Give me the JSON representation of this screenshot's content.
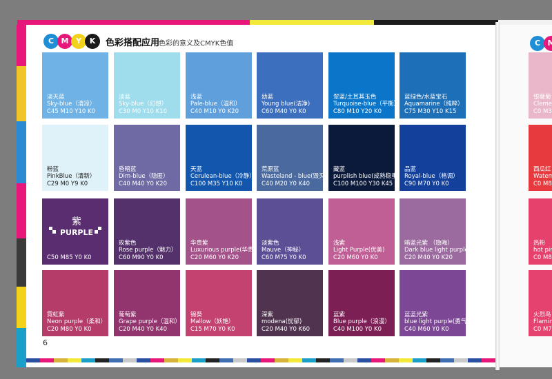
{
  "colors": {
    "cyan": "#1e8fd6",
    "magenta": "#e8177a",
    "yellow": "#f2d21b",
    "black": "#1a1a1a",
    "strip": [
      "#2b4fa3",
      "#e8177a",
      "#d8b33a",
      "#f2e93a",
      "#1aa0c8",
      "#232323",
      "#3f6fb0",
      "#c9c9c9"
    ]
  },
  "header": {
    "c": "C",
    "m": "M",
    "y": "Y",
    "k": "K",
    "title": "色彩搭配应用",
    "subtitle": "色彩的意义及CMYK色值"
  },
  "page_number": "6",
  "swatches": [
    {
      "color": "#6fb3e6",
      "name_cn": "淡天蓝",
      "name_en": "Sky-blue（清凉）",
      "cmyk": "C45 M10 Y10 K0"
    },
    {
      "color": "#9fdcec",
      "name_cn": "淡蓝",
      "name_en": "Sky-blue（幻想）",
      "cmyk": "C30 M0 Y10 K10"
    },
    {
      "color": "#5e9fdc",
      "name_cn": "浅蓝",
      "name_en": "Pale-blue（温和）",
      "cmyk": "C40 M10 Y0 K20"
    },
    {
      "color": "#3d6fbf",
      "name_cn": "幼蓝",
      "name_en": "Young blue(洁净)",
      "cmyk": "C60 M40 Y0 K0"
    },
    {
      "color": "#0b76c9",
      "name_cn": "翠蓝/土耳其玉色",
      "name_en": "Turquoise-blue（平衡）",
      "cmyk": "C80 M10 Y20 K0"
    },
    {
      "color": "#1d6fb8",
      "name_cn": "蓝绿色/水蓝宝石",
      "name_en": "Aquamarine（纯粹）",
      "cmyk": "C75 M30 Y10 K15"
    },
    {
      "color": "#dff2fa",
      "name_cn": "粉蓝",
      "name_en": "PinkBlue（清新）",
      "cmyk": "C29 M0 Y9 K0",
      "dark": true
    },
    {
      "color": "#6f6aa3",
      "name_cn": "昏暗蓝",
      "name_en": "Dim-blue（隐匿）",
      "cmyk": "C40 M40 Y0 K20"
    },
    {
      "color": "#1256ad",
      "name_cn": "天蓝",
      "name_en": "Cerulean-blue（冷静）",
      "cmyk": "C100 M35 Y10 K0"
    },
    {
      "color": "#4a6a9f",
      "name_cn": "荒原蓝",
      "name_en": "Wasteland - blue(毁灭)",
      "cmyk": "C40 M20 Y0 K40"
    },
    {
      "color": "#0b1a3a",
      "name_cn": "藏蓝",
      "name_en": "purplish blue(成熟稳重)",
      "cmyk": "C100 M100 Y30 K45"
    },
    {
      "color": "#12409b",
      "name_cn": "品蓝",
      "name_en": "Royal-blue（格调）",
      "cmyk": "C90 M70 Y0 K0"
    },
    {
      "color": "#5a2c70",
      "name_cn": "紫",
      "name_en": "PURPLE",
      "cmyk": "C50 M85 Y0 K0",
      "logo": true
    },
    {
      "color": "#55316c",
      "name_cn": "玫紫色",
      "name_en": "Rose purple（魅力）",
      "cmyk": "C60  M90 Y0 K0"
    },
    {
      "color": "#a4528a",
      "name_cn": "华贵紫",
      "name_en": "Luxurious purple(华贵)",
      "cmyk": "C20 M60 Y0 K20"
    },
    {
      "color": "#5c4f95",
      "name_cn": "淡紫色",
      "name_en": "Mauve（神秘）",
      "cmyk": "C60 M75 Y0 K0"
    },
    {
      "color": "#c05f95",
      "name_cn": "浅紫",
      "name_en": "Light Purple(优美)",
      "cmyk": "C20 M60 Y0 K0"
    },
    {
      "color": "#9b6a9e",
      "name_cn": "暗蓝光紫    （隐晦）",
      "name_en": "Dark blue light purple",
      "cmyk": "C20 M40 Y0 K20"
    },
    {
      "color": "#b53c69",
      "name_cn": "霓虹紫",
      "name_en": "Neon purple（柔和）",
      "cmyk": "C20 M80 Y0 K0"
    },
    {
      "color": "#92346d",
      "name_cn": "葡萄紫",
      "name_en": "Grape purple（温和）",
      "cmyk": "C20 M40 Y0 K40"
    },
    {
      "color": "#c4426f",
      "name_cn": "锦葵",
      "name_en": "Mallow（妖艳）",
      "cmyk": "C15 M70 Y0 K0"
    },
    {
      "color": "#50344f",
      "name_cn": "深紫",
      "name_en": "modena(忧郁)",
      "cmyk": "C20 M40 Y0 K60"
    },
    {
      "color": "#7c1f55",
      "name_cn": "蓝紫",
      "name_en": "Blue purple（浪漫）",
      "cmyk": "C40 M100 Y0 K0"
    },
    {
      "color": "#7c4895",
      "name_cn": "蓝蓝光紫",
      "name_en": "blue light purple(勇气)",
      "cmyk": "C40 M60 Y0 K0"
    }
  ],
  "right_page": {
    "rows": [
      {
        "color": "#e9b7c9",
        "line1": "银薇菊",
        "line2": "Cleme",
        "line3": "C0 M3"
      },
      {
        "color": "#e63a3f",
        "line1": "西瓜红",
        "line2": "Watem",
        "line3": "C0 M8"
      },
      {
        "color": "#e6416d",
        "line1": "热粉",
        "line2": "hot pin",
        "line3": "C0 M8"
      },
      {
        "color": "#e6426f",
        "line1": "火烈鸟",
        "line2": "Flamin",
        "line3": "C0 M7"
      }
    ]
  }
}
